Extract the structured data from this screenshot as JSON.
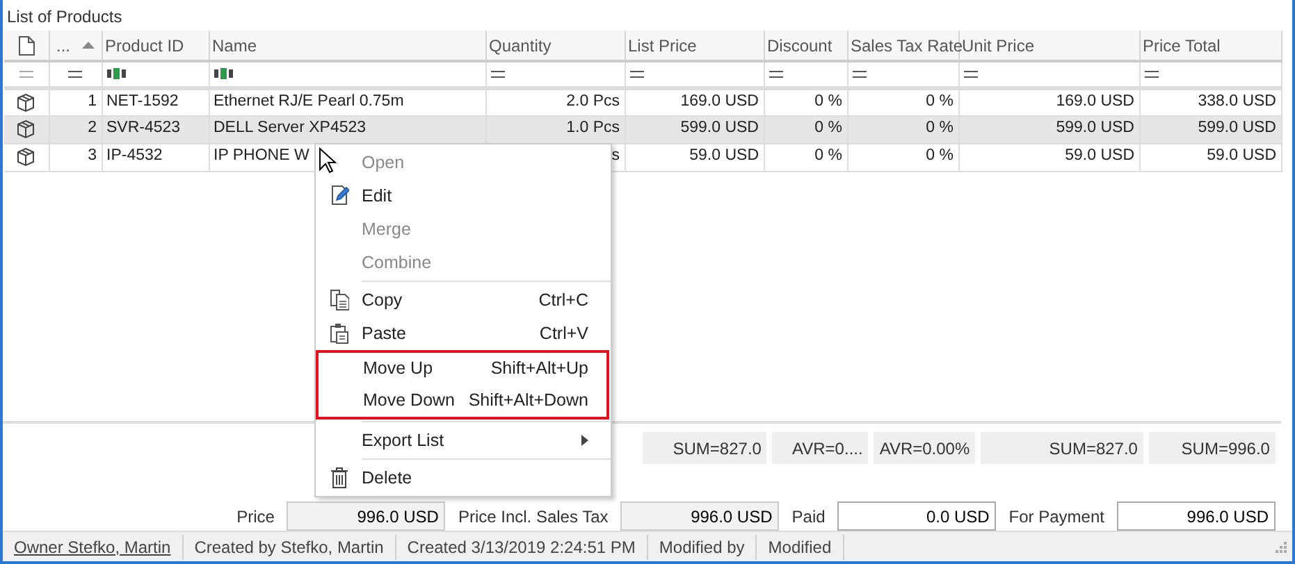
{
  "panel": {
    "title": "List of Products"
  },
  "table": {
    "columns": [
      {
        "label": "...",
        "sorted": true
      },
      {
        "label": "Product ID",
        "sorted": false
      },
      {
        "label": "Name",
        "sorted": false
      },
      {
        "label": "Quantity",
        "sorted": false
      },
      {
        "label": "List Price",
        "sorted": false
      },
      {
        "label": "Discount",
        "sorted": false
      },
      {
        "label": "Sales Tax Rate",
        "sorted": false
      },
      {
        "label": "Unit Price",
        "sorted": false
      },
      {
        "label": "Price Total",
        "sorted": false
      }
    ],
    "rows": [
      {
        "selected": false,
        "cells": [
          "1",
          "NET-1592",
          "Ethernet RJ/E Pearl 0.75m",
          "2.0 Pcs",
          "169.0 USD",
          "0 %",
          "0 %",
          "169.0 USD",
          "338.0 USD"
        ]
      },
      {
        "selected": true,
        "cells": [
          "2",
          "SVR-4523",
          "DELL Server XP4523",
          "1.0 Pcs",
          "599.0 USD",
          "0 %",
          "0 %",
          "599.0 USD",
          "599.0 USD"
        ]
      },
      {
        "selected": false,
        "cells": [
          "3",
          "IP-4532",
          "IP PHONE W",
          "s",
          "59.0 USD",
          "0 %",
          "0 %",
          "59.0 USD",
          "59.0 USD"
        ]
      }
    ],
    "summary": [
      "SUM=827.0",
      "AVR=0....",
      "AVR=0.00%",
      "SUM=827.0",
      "SUM=996.0"
    ]
  },
  "totals": [
    {
      "label": "Price",
      "value": "996.0 USD",
      "readonly": true
    },
    {
      "label": "Price Incl. Sales Tax",
      "value": "996.0 USD",
      "readonly": true
    },
    {
      "label": "Paid",
      "value": "0.0 USD",
      "readonly": false
    },
    {
      "label": "For Payment",
      "value": "996.0 USD",
      "readonly": false
    }
  ],
  "context_menu": [
    {
      "label": "Open",
      "disabled": true,
      "separator_before": false,
      "highlighted": false
    },
    {
      "label": "Edit",
      "disabled": false,
      "separator_before": false,
      "highlighted": false
    },
    {
      "label": "Merge",
      "disabled": true,
      "separator_before": false,
      "highlighted": false
    },
    {
      "label": "Combine",
      "disabled": true,
      "separator_before": false,
      "highlighted": false
    },
    {
      "label": "Copy",
      "shortcut": "Ctrl+C",
      "disabled": false,
      "separator_before": true,
      "highlighted": false
    },
    {
      "label": "Paste",
      "shortcut": "Ctrl+V",
      "disabled": false,
      "separator_before": false,
      "highlighted": false
    },
    {
      "label": "Move Up",
      "shortcut": "Shift+Alt+Up",
      "disabled": false,
      "separator_before": false,
      "highlighted": true
    },
    {
      "label": "Move Down",
      "shortcut": "Shift+Alt+Down",
      "disabled": false,
      "separator_before": false,
      "highlighted": true
    },
    {
      "label": "Export List",
      "submenu": true,
      "disabled": false,
      "separator_before": true,
      "highlighted": false
    },
    {
      "label": "Delete",
      "disabled": false,
      "separator_before": true,
      "highlighted": false
    }
  ],
  "status_bar": [
    {
      "text": "Owner Stefko, Martin",
      "link": true
    },
    {
      "text": "Created by Stefko, Martin",
      "link": false
    },
    {
      "text": "Created 3/13/2019 2:24:51 PM",
      "link": false
    },
    {
      "text": "Modified by",
      "link": false
    },
    {
      "text": "Modified",
      "link": false
    }
  ]
}
